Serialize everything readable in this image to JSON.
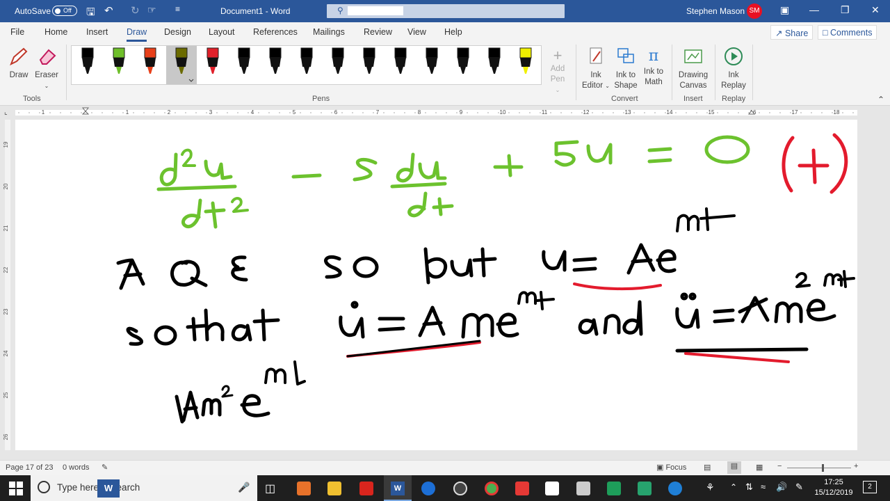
{
  "title_bar": {
    "autosave_label": "AutoSave",
    "autosave_state": "Off",
    "document_title": "Document1  -  Word",
    "user_name": "Stephen Mason",
    "user_initials": "SM"
  },
  "tabs": [
    "File",
    "Home",
    "Insert",
    "Draw",
    "Design",
    "Layout",
    "References",
    "Mailings",
    "Review",
    "View",
    "Help"
  ],
  "active_tab": "Draw",
  "share_label": "Share",
  "comments_label": "Comments",
  "ribbon": {
    "draw_label": "Draw",
    "eraser_label": "Eraser",
    "tools_group": "Tools",
    "pens_group": "Pens",
    "add_pen_line1": "Add",
    "add_pen_line2": "Pen",
    "ink_editor_line1": "Ink",
    "ink_editor_line2": "Editor",
    "ink_shape_line1": "Ink to",
    "ink_shape_line2": "Shape",
    "ink_math_line1": "Ink to",
    "ink_math_line2": "Math",
    "convert_group": "Convert",
    "canvas_line1": "Drawing",
    "canvas_line2": "Canvas",
    "insert_group": "Insert",
    "replay_line1": "Ink",
    "replay_line2": "Replay",
    "replay_group": "Replay",
    "pen_colors": [
      "#000000",
      "#6fbf2b",
      "#e8401a",
      "#6b6b00",
      "#e0202a",
      "#000000",
      "#000000",
      "#000000",
      "#000000",
      "#000000",
      "#000000",
      "#000000",
      "#000000",
      "#000000",
      "#f0f000"
    ]
  },
  "ruler_numbers": [
    "1",
    "1",
    "2",
    "3",
    "4",
    "5",
    "6",
    "7",
    "8",
    "9",
    "10",
    "11",
    "12",
    "13",
    "14",
    "15",
    "16",
    "17",
    "18"
  ],
  "vruler_numbers": [
    "19",
    "20",
    "21",
    "22",
    "23",
    "24",
    "25",
    "26"
  ],
  "status": {
    "page": "Page 17 of 23",
    "words": "0 words",
    "focus": "Focus"
  },
  "taskbar": {
    "search_placeholder": "Type here to search",
    "time": "17:25",
    "date": "15/12/2019",
    "notification_count": "2"
  },
  "ink_colors": {
    "green": "#6cc22e",
    "red": "#e31b2d",
    "black": "#000000"
  }
}
